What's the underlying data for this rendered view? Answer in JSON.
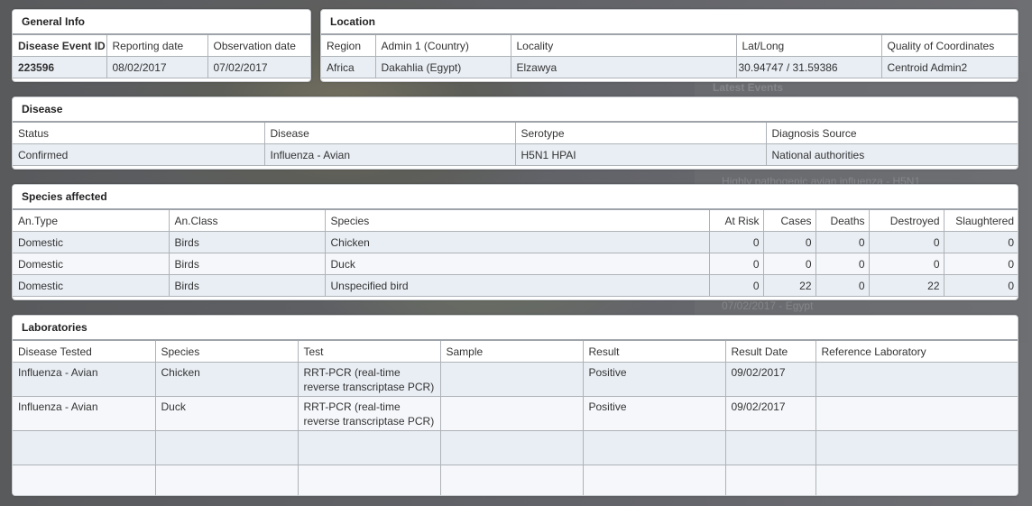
{
  "background": {
    "ghost_texts": [
      "Latest Events",
      "Highly pathogenic avian influenza - H5N1",
      "07/02/2017 - Egypt"
    ]
  },
  "general_info": {
    "title": "General Info",
    "headers": [
      "Disease Event ID",
      "Reporting date",
      "Observation date"
    ],
    "row": [
      "223596",
      "08/02/2017",
      "07/02/2017"
    ]
  },
  "location": {
    "title": "Location",
    "headers": [
      "Region",
      "Admin 1 (Country)",
      "Locality",
      "Lat/Long",
      "Quality of Coordinates"
    ],
    "row": [
      "Africa",
      "Dakahlia (Egypt)",
      "Elzawya",
      "30.94747 / 31.59386",
      "Centroid Admin2"
    ]
  },
  "disease": {
    "title": "Disease",
    "headers": [
      "Status",
      "Disease",
      "Serotype",
      "Diagnosis Source"
    ],
    "row": [
      "Confirmed",
      "Influenza - Avian",
      "H5N1 HPAI",
      "National authorities"
    ]
  },
  "species": {
    "title": "Species affected",
    "headers": [
      "An.Type",
      "An.Class",
      "Species",
      "At Risk",
      "Cases",
      "Deaths",
      "Destroyed",
      "Slaughtered"
    ],
    "rows": [
      [
        "Domestic",
        "Birds",
        "Chicken",
        "0",
        "0",
        "0",
        "0",
        "0"
      ],
      [
        "Domestic",
        "Birds",
        "Duck",
        "0",
        "0",
        "0",
        "0",
        "0"
      ],
      [
        "Domestic",
        "Birds",
        "Unspecified bird",
        "0",
        "22",
        "0",
        "22",
        "0"
      ]
    ]
  },
  "laboratories": {
    "title": "Laboratories",
    "headers": [
      "Disease Tested",
      "Species",
      "Test",
      "Sample",
      "Result",
      "Result Date",
      "Reference Laboratory"
    ],
    "rows": [
      [
        "Influenza - Avian",
        "Chicken",
        "RRT-PCR (real-time reverse transcriptase PCR)",
        "",
        "Positive",
        "09/02/2017",
        ""
      ],
      [
        "Influenza - Avian",
        "Duck",
        "RRT-PCR (real-time reverse transcriptase PCR)",
        "",
        "Positive",
        "09/02/2017",
        ""
      ]
    ]
  }
}
